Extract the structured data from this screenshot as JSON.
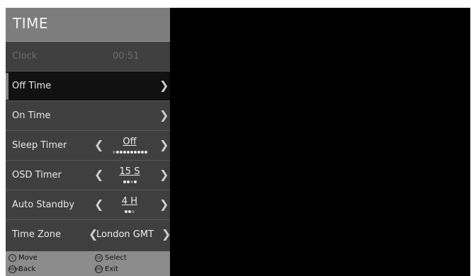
{
  "menu": {
    "title": "TIME",
    "rows": [
      {
        "label": "Clock",
        "value": "00:51"
      },
      {
        "label": "Off Time"
      },
      {
        "label": "On Time"
      },
      {
        "label": "Sleep Timer",
        "value": "Off"
      },
      {
        "label": "OSD Timer",
        "value": "15 S"
      },
      {
        "label": "Auto Standby",
        "value": "4 H"
      },
      {
        "label": "Time Zone",
        "value": "London GMT"
      }
    ],
    "step_indicators": {
      "sleep_timer": {
        "total": 10,
        "position": 1
      },
      "osd_timer": {
        "total": 4,
        "position": 3
      },
      "auto_standby": {
        "total": 3,
        "position": 3
      }
    }
  },
  "footer": {
    "move": "Move",
    "select": "Select",
    "back": "Back",
    "exit": "Exit",
    "select_icon": "OK",
    "back_icon": "MENU",
    "exit_icon": "EXIT"
  },
  "colors": {
    "panel": "#3f3f3f",
    "header": "#7d7d7d",
    "selected_row": "#111111",
    "footer": "#8c8c8c",
    "screen": "#000000"
  }
}
